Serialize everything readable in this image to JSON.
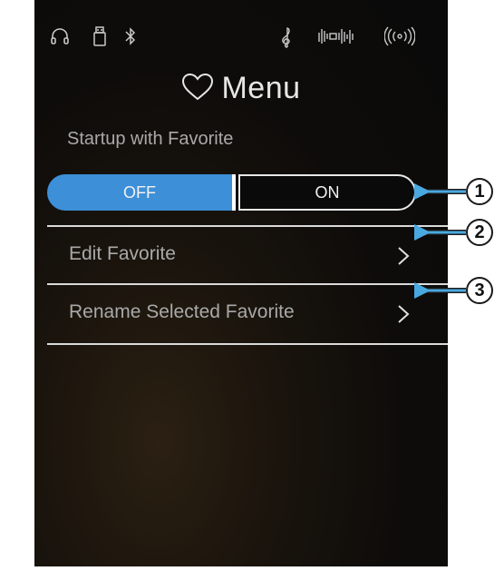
{
  "status_icons": [
    "headphones-icon",
    "usb-icon",
    "bluetooth-icon",
    "treble-clef-icon",
    "audio-wave-icon",
    "wireless-icon"
  ],
  "header": {
    "title": "Menu",
    "icon": "heart-outline-icon"
  },
  "startup": {
    "label": "Startup with Favorite",
    "off_label": "OFF",
    "on_label": "ON",
    "selected": "OFF"
  },
  "menu": {
    "items": [
      {
        "label": "Edit Favorite",
        "icon": "chevron-right-icon"
      },
      {
        "label": "Rename Selected Favorite",
        "icon": "chevron-right-icon"
      }
    ]
  },
  "callouts": [
    "1",
    "2",
    "3"
  ],
  "colors": {
    "accent": "#3d8fd8",
    "background": "#0a0a0a",
    "callout_arrow": "#4aa8e0"
  }
}
